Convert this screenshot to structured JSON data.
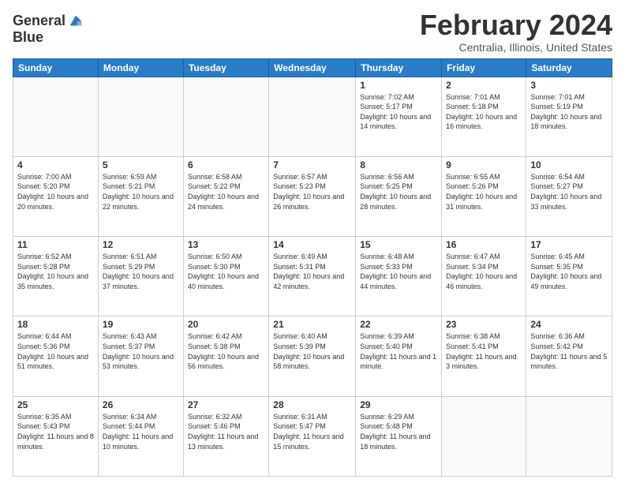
{
  "header": {
    "logo": {
      "line1": "General",
      "line2": "Blue"
    },
    "title": "February 2024",
    "subtitle": "Centralia, Illinois, United States"
  },
  "weekdays": [
    "Sunday",
    "Monday",
    "Tuesday",
    "Wednesday",
    "Thursday",
    "Friday",
    "Saturday"
  ],
  "weeks": [
    [
      {
        "day": "",
        "sunrise": "",
        "sunset": "",
        "daylight": ""
      },
      {
        "day": "",
        "sunrise": "",
        "sunset": "",
        "daylight": ""
      },
      {
        "day": "",
        "sunrise": "",
        "sunset": "",
        "daylight": ""
      },
      {
        "day": "",
        "sunrise": "",
        "sunset": "",
        "daylight": ""
      },
      {
        "day": "1",
        "sunrise": "Sunrise: 7:02 AM",
        "sunset": "Sunset: 5:17 PM",
        "daylight": "Daylight: 10 hours and 14 minutes."
      },
      {
        "day": "2",
        "sunrise": "Sunrise: 7:01 AM",
        "sunset": "Sunset: 5:18 PM",
        "daylight": "Daylight: 10 hours and 16 minutes."
      },
      {
        "day": "3",
        "sunrise": "Sunrise: 7:01 AM",
        "sunset": "Sunset: 5:19 PM",
        "daylight": "Daylight: 10 hours and 18 minutes."
      }
    ],
    [
      {
        "day": "4",
        "sunrise": "Sunrise: 7:00 AM",
        "sunset": "Sunset: 5:20 PM",
        "daylight": "Daylight: 10 hours and 20 minutes."
      },
      {
        "day": "5",
        "sunrise": "Sunrise: 6:59 AM",
        "sunset": "Sunset: 5:21 PM",
        "daylight": "Daylight: 10 hours and 22 minutes."
      },
      {
        "day": "6",
        "sunrise": "Sunrise: 6:58 AM",
        "sunset": "Sunset: 5:22 PM",
        "daylight": "Daylight: 10 hours and 24 minutes."
      },
      {
        "day": "7",
        "sunrise": "Sunrise: 6:57 AM",
        "sunset": "Sunset: 5:23 PM",
        "daylight": "Daylight: 10 hours and 26 minutes."
      },
      {
        "day": "8",
        "sunrise": "Sunrise: 6:56 AM",
        "sunset": "Sunset: 5:25 PM",
        "daylight": "Daylight: 10 hours and 28 minutes."
      },
      {
        "day": "9",
        "sunrise": "Sunrise: 6:55 AM",
        "sunset": "Sunset: 5:26 PM",
        "daylight": "Daylight: 10 hours and 31 minutes."
      },
      {
        "day": "10",
        "sunrise": "Sunrise: 6:54 AM",
        "sunset": "Sunset: 5:27 PM",
        "daylight": "Daylight: 10 hours and 33 minutes."
      }
    ],
    [
      {
        "day": "11",
        "sunrise": "Sunrise: 6:52 AM",
        "sunset": "Sunset: 5:28 PM",
        "daylight": "Daylight: 10 hours and 35 minutes."
      },
      {
        "day": "12",
        "sunrise": "Sunrise: 6:51 AM",
        "sunset": "Sunset: 5:29 PM",
        "daylight": "Daylight: 10 hours and 37 minutes."
      },
      {
        "day": "13",
        "sunrise": "Sunrise: 6:50 AM",
        "sunset": "Sunset: 5:30 PM",
        "daylight": "Daylight: 10 hours and 40 minutes."
      },
      {
        "day": "14",
        "sunrise": "Sunrise: 6:49 AM",
        "sunset": "Sunset: 5:31 PM",
        "daylight": "Daylight: 10 hours and 42 minutes."
      },
      {
        "day": "15",
        "sunrise": "Sunrise: 6:48 AM",
        "sunset": "Sunset: 5:33 PM",
        "daylight": "Daylight: 10 hours and 44 minutes."
      },
      {
        "day": "16",
        "sunrise": "Sunrise: 6:47 AM",
        "sunset": "Sunset: 5:34 PM",
        "daylight": "Daylight: 10 hours and 46 minutes."
      },
      {
        "day": "17",
        "sunrise": "Sunrise: 6:45 AM",
        "sunset": "Sunset: 5:35 PM",
        "daylight": "Daylight: 10 hours and 49 minutes."
      }
    ],
    [
      {
        "day": "18",
        "sunrise": "Sunrise: 6:44 AM",
        "sunset": "Sunset: 5:36 PM",
        "daylight": "Daylight: 10 hours and 51 minutes."
      },
      {
        "day": "19",
        "sunrise": "Sunrise: 6:43 AM",
        "sunset": "Sunset: 5:37 PM",
        "daylight": "Daylight: 10 hours and 53 minutes."
      },
      {
        "day": "20",
        "sunrise": "Sunrise: 6:42 AM",
        "sunset": "Sunset: 5:38 PM",
        "daylight": "Daylight: 10 hours and 56 minutes."
      },
      {
        "day": "21",
        "sunrise": "Sunrise: 6:40 AM",
        "sunset": "Sunset: 5:39 PM",
        "daylight": "Daylight: 10 hours and 58 minutes."
      },
      {
        "day": "22",
        "sunrise": "Sunrise: 6:39 AM",
        "sunset": "Sunset: 5:40 PM",
        "daylight": "Daylight: 11 hours and 1 minute."
      },
      {
        "day": "23",
        "sunrise": "Sunrise: 6:38 AM",
        "sunset": "Sunset: 5:41 PM",
        "daylight": "Daylight: 11 hours and 3 minutes."
      },
      {
        "day": "24",
        "sunrise": "Sunrise: 6:36 AM",
        "sunset": "Sunset: 5:42 PM",
        "daylight": "Daylight: 11 hours and 5 minutes."
      }
    ],
    [
      {
        "day": "25",
        "sunrise": "Sunrise: 6:35 AM",
        "sunset": "Sunset: 5:43 PM",
        "daylight": "Daylight: 11 hours and 8 minutes."
      },
      {
        "day": "26",
        "sunrise": "Sunrise: 6:34 AM",
        "sunset": "Sunset: 5:44 PM",
        "daylight": "Daylight: 11 hours and 10 minutes."
      },
      {
        "day": "27",
        "sunrise": "Sunrise: 6:32 AM",
        "sunset": "Sunset: 5:46 PM",
        "daylight": "Daylight: 11 hours and 13 minutes."
      },
      {
        "day": "28",
        "sunrise": "Sunrise: 6:31 AM",
        "sunset": "Sunset: 5:47 PM",
        "daylight": "Daylight: 11 hours and 15 minutes."
      },
      {
        "day": "29",
        "sunrise": "Sunrise: 6:29 AM",
        "sunset": "Sunset: 5:48 PM",
        "daylight": "Daylight: 11 hours and 18 minutes."
      },
      {
        "day": "",
        "sunrise": "",
        "sunset": "",
        "daylight": ""
      },
      {
        "day": "",
        "sunrise": "",
        "sunset": "",
        "daylight": ""
      }
    ]
  ]
}
